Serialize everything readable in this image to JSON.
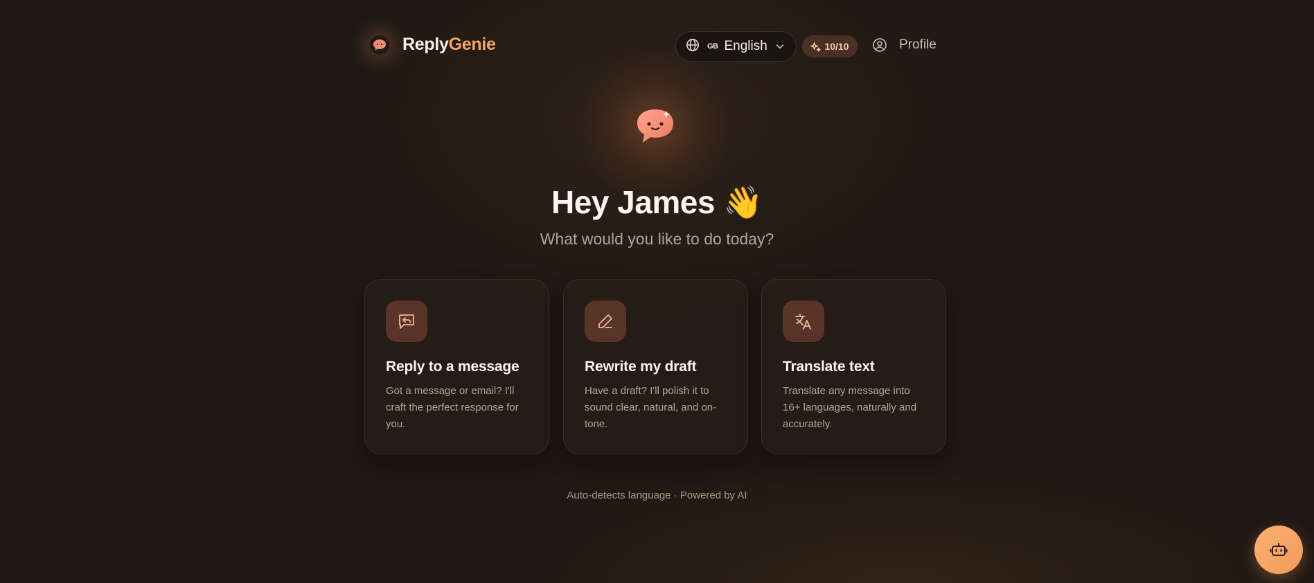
{
  "brand": {
    "name_part1": "Reply",
    "name_part2": "Genie",
    "icon": "chat-bubble-icon"
  },
  "header": {
    "language": {
      "flag": "GB",
      "label": "English",
      "icon": "globe-icon"
    },
    "credits": {
      "label": "10/10",
      "icon": "sparkle-icon"
    },
    "profile": {
      "label": "Profile",
      "icon": "user-circle-icon"
    }
  },
  "hero": {
    "greeting": "Hey James 👋",
    "subtitle": "What would you like to do today?"
  },
  "cards": [
    {
      "title": "Reply to a message",
      "description": "Got a message or email? I'll craft the perfect response for you.",
      "icon": "reply-icon"
    },
    {
      "title": "Rewrite my draft",
      "description": "Have a draft? I'll polish it to sound clear, natural, and on-tone.",
      "icon": "pencil-icon"
    },
    {
      "title": "Translate text",
      "description": "Translate any message into 16+ languages, naturally and accurately.",
      "icon": "translate-icon"
    }
  ],
  "footer": {
    "note": "Auto-detects language · Powered by AI"
  },
  "fab": {
    "icon": "bot-icon"
  },
  "colors": {
    "accent": "#F4A463",
    "background": "#1F1813",
    "card_icon_bg": "#5A3428"
  }
}
